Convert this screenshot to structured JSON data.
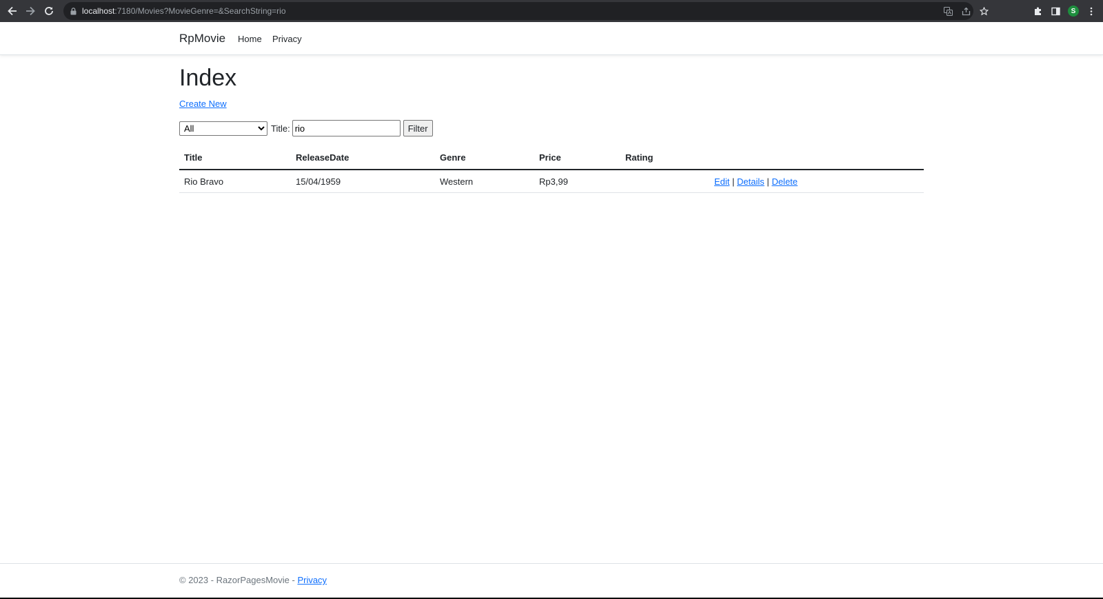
{
  "browser": {
    "url_host": "localhost",
    "url_rest": ":7180/Movies?MovieGenre=&SearchString=rio",
    "profile_initial": "S"
  },
  "navbar": {
    "brand": "RpMovie",
    "links": [
      "Home",
      "Privacy"
    ]
  },
  "page": {
    "title": "Index",
    "create_link": "Create New"
  },
  "filter": {
    "genre_selected": "All",
    "title_label": "Title:",
    "search_value": "rio",
    "button_label": "Filter"
  },
  "table": {
    "headers": [
      "Title",
      "ReleaseDate",
      "Genre",
      "Price",
      "Rating"
    ],
    "rows": [
      {
        "title": "Rio Bravo",
        "release_date": "15/04/1959",
        "genre": "Western",
        "price": "Rp3,99",
        "rating": "",
        "actions": [
          "Edit",
          "Details",
          "Delete"
        ]
      }
    ],
    "separator": "|"
  },
  "footer": {
    "text": "© 2023 - RazorPagesMovie - ",
    "privacy_link": "Privacy"
  }
}
